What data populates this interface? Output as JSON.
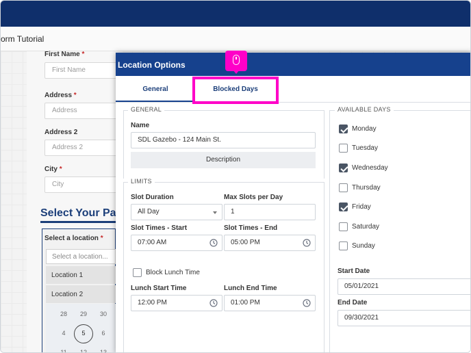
{
  "app": {
    "title": "orm Tutorial",
    "fields": [
      {
        "label": "First Name",
        "required": "*",
        "placeholder": "First Name"
      },
      {
        "label": "Address",
        "required": "*",
        "placeholder": "Address"
      },
      {
        "label": "Address 2",
        "required": "",
        "placeholder": "Address 2"
      },
      {
        "label": "City",
        "required": "*",
        "placeholder": "City"
      }
    ],
    "section_heading": "Select Your Pa",
    "location_label": "Select a location",
    "location_required": "*",
    "location_placeholder": "Select a location...",
    "location_items": [
      "Location 1",
      "Location 2"
    ],
    "calendar_numbers": [
      "28",
      "29",
      "30",
      "4",
      "5",
      "6",
      "11",
      "12",
      "13"
    ]
  },
  "modal": {
    "title": "Location Options",
    "tabs": [
      {
        "label": "General",
        "active": true
      },
      {
        "label": "Blocked Days",
        "active": false
      }
    ],
    "general": {
      "legend": "GENERAL",
      "name_label": "Name",
      "name_value": "SDL Gazebo - 124 Main St.",
      "description_button": "Description"
    },
    "limits": {
      "legend": "LIMITS",
      "slot_duration_label": "Slot Duration",
      "slot_duration_value": "All Day",
      "max_slots_label": "Max Slots per Day",
      "max_slots_value": "1",
      "slot_start_label": "Slot Times - Start",
      "slot_start_value": "07:00 AM",
      "slot_end_label": "Slot Times - End",
      "slot_end_value": "05:00 PM",
      "block_lunch_label": "Block Lunch Time",
      "block_lunch_checked": false,
      "lunch_start_label": "Lunch Start Time",
      "lunch_start_value": "12:00 PM",
      "lunch_end_label": "Lunch End Time",
      "lunch_end_value": "01:00 PM"
    },
    "available_days": {
      "legend": "AVAILABLE DAYS",
      "days": [
        {
          "label": "Monday",
          "checked": true
        },
        {
          "label": "Tuesday",
          "checked": false
        },
        {
          "label": "Wednesday",
          "checked": true
        },
        {
          "label": "Thursday",
          "checked": false
        },
        {
          "label": "Friday",
          "checked": true
        },
        {
          "label": "Saturday",
          "checked": false
        },
        {
          "label": "Sunday",
          "checked": false
        }
      ],
      "start_date_label": "Start Date",
      "start_date_value": "05/01/2021",
      "end_date_label": "End Date",
      "end_date_value": "09/30/2021"
    }
  },
  "colors": {
    "app_topbar": "#0f2f6b",
    "modal_header": "#16418d",
    "highlight": "#ff00c8",
    "heading_blue": "#1c3f7a"
  },
  "icons": {
    "cursor": "mouse-icon",
    "time": "clock-icon",
    "dropdown": "caret-down-icon"
  }
}
